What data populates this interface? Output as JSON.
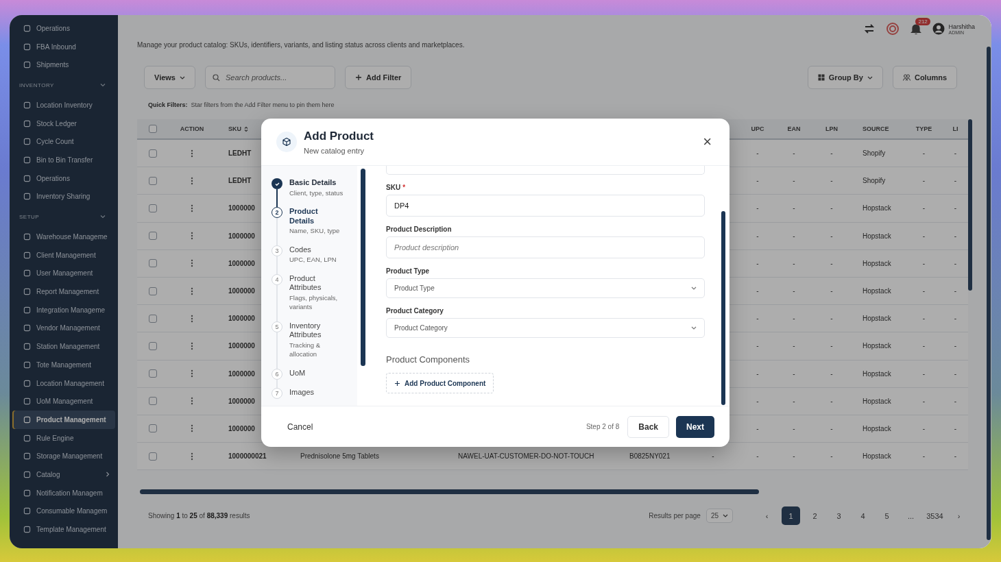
{
  "sidebar": {
    "items": [
      {
        "kind": "item",
        "label": "Operations",
        "selected": false
      },
      {
        "kind": "item",
        "label": "FBA Inbound",
        "selected": false
      },
      {
        "kind": "item",
        "label": "Shipments",
        "selected": false
      },
      {
        "kind": "section",
        "label": "INVENTORY"
      },
      {
        "kind": "item",
        "label": "Location Inventory",
        "selected": false
      },
      {
        "kind": "item",
        "label": "Stock Ledger",
        "selected": false
      },
      {
        "kind": "item",
        "label": "Cycle Count",
        "selected": false
      },
      {
        "kind": "item",
        "label": "Bin to Bin Transfer",
        "selected": false
      },
      {
        "kind": "item",
        "label": "Operations",
        "selected": false
      },
      {
        "kind": "item",
        "label": "Inventory Sharing",
        "selected": false
      },
      {
        "kind": "section",
        "label": "SETUP"
      },
      {
        "kind": "item",
        "label": "Warehouse Manageme",
        "selected": false
      },
      {
        "kind": "item",
        "label": "Client Management",
        "selected": false
      },
      {
        "kind": "item",
        "label": "User Management",
        "selected": false
      },
      {
        "kind": "item",
        "label": "Report Management",
        "selected": false
      },
      {
        "kind": "item",
        "label": "Integration Manageme",
        "selected": false
      },
      {
        "kind": "item",
        "label": "Vendor Management",
        "selected": false
      },
      {
        "kind": "item",
        "label": "Station Management",
        "selected": false
      },
      {
        "kind": "item",
        "label": "Tote Management",
        "selected": false
      },
      {
        "kind": "item",
        "label": "Location Management",
        "selected": false
      },
      {
        "kind": "item",
        "label": "UoM Management",
        "selected": false
      },
      {
        "kind": "item",
        "label": "Product Management",
        "selected": true
      },
      {
        "kind": "item",
        "label": "Rule Engine",
        "selected": false
      },
      {
        "kind": "item",
        "label": "Storage Management",
        "selected": false
      },
      {
        "kind": "item",
        "label": "Catalog",
        "selected": false,
        "expanded": false
      },
      {
        "kind": "item",
        "label": "Notification Managem",
        "selected": false
      },
      {
        "kind": "item",
        "label": "Consumable Managem",
        "selected": false
      },
      {
        "kind": "item",
        "label": "Template Management",
        "selected": false
      }
    ]
  },
  "header": {
    "description": "Manage your product catalog: SKUs, identifiers, variants, and listing status across clients and marketplaces.",
    "notification_count": "212",
    "user_name": "Harshitha",
    "user_role": "ADMIN"
  },
  "toolbar": {
    "views": "Views",
    "search_placeholder": "Search products...",
    "add_filter": "Add Filter",
    "group_by": "Group By",
    "columns": "Columns"
  },
  "quick_filters": {
    "label": "Quick Filters:",
    "hint": "Star filters from the Add Filter menu to pin them here"
  },
  "table": {
    "header_checked": false,
    "columns": [
      "",
      "ACTION",
      "SKU",
      "",
      "",
      "",
      "",
      "UPC",
      "EAN",
      "LPN",
      "SOURCE",
      "TYPE",
      "LI"
    ],
    "rows": [
      {
        "checked": false,
        "cells": [
          "",
          "",
          "LEDHT",
          "",
          "",
          "",
          "",
          "-",
          "-",
          "-",
          "Shopify",
          "-",
          "-"
        ]
      },
      {
        "checked": false,
        "cells": [
          "",
          "",
          "LEDHT",
          "",
          "",
          "",
          "",
          "-",
          "-",
          "-",
          "Shopify",
          "-",
          "-"
        ]
      },
      {
        "checked": false,
        "cells": [
          "",
          "",
          "1000000",
          "",
          "",
          "",
          "",
          "-",
          "-",
          "-",
          "Hopstack",
          "-",
          "-"
        ]
      },
      {
        "checked": false,
        "cells": [
          "",
          "",
          "1000000",
          "",
          "",
          "",
          "",
          "-",
          "-",
          "-",
          "Hopstack",
          "-",
          "-"
        ]
      },
      {
        "checked": false,
        "cells": [
          "",
          "",
          "1000000",
          "",
          "",
          "",
          "",
          "-",
          "-",
          "-",
          "Hopstack",
          "-",
          "-"
        ]
      },
      {
        "checked": false,
        "cells": [
          "",
          "",
          "1000000",
          "",
          "",
          "",
          "",
          "-",
          "-",
          "-",
          "Hopstack",
          "-",
          "-"
        ]
      },
      {
        "checked": false,
        "cells": [
          "",
          "",
          "1000000",
          "",
          "",
          "",
          "",
          "-",
          "-",
          "-",
          "Hopstack",
          "-",
          "-"
        ]
      },
      {
        "checked": false,
        "cells": [
          "",
          "",
          "1000000",
          "",
          "",
          "",
          "",
          "-",
          "-",
          "-",
          "Hopstack",
          "-",
          "-"
        ]
      },
      {
        "checked": false,
        "cells": [
          "",
          "",
          "1000000",
          "",
          "",
          "",
          "",
          "-",
          "-",
          "-",
          "Hopstack",
          "-",
          "-"
        ]
      },
      {
        "checked": false,
        "cells": [
          "",
          "",
          "1000000",
          "",
          "",
          "",
          "",
          "-",
          "-",
          "-",
          "Hopstack",
          "-",
          "-"
        ]
      },
      {
        "checked": false,
        "cells": [
          "",
          "",
          "1000000",
          "",
          "",
          "",
          "",
          "-",
          "-",
          "-",
          "Hopstack",
          "-",
          "-"
        ]
      },
      {
        "checked": false,
        "cells": [
          "",
          "",
          "1000000021",
          "Prednisolone 5mg Tablets",
          "NAWEL-UAT-CUSTOMER-DO-NOT-TOUCH",
          "B0825NY021",
          "-",
          "-",
          "-",
          "-",
          "Hopstack",
          "-",
          "-"
        ]
      }
    ]
  },
  "pagination": {
    "summary": "Showing **1** to **25** of **88,339** results",
    "per_page_label": "Results per page",
    "per_page": "25",
    "prev": "‹",
    "next": "›",
    "pages": [
      {
        "label": "1",
        "selected": true
      },
      {
        "label": "2",
        "selected": false
      },
      {
        "label": "3",
        "selected": false
      },
      {
        "label": "4",
        "selected": false
      },
      {
        "label": "5",
        "selected": false
      },
      {
        "label": "...",
        "selected": false
      },
      {
        "label": "3534",
        "selected": false
      }
    ]
  },
  "modal": {
    "title": "Add Product",
    "subtitle": "New catalog entry",
    "close": "×",
    "steps": [
      {
        "title": "Basic Details",
        "subtitle": "Client, type, status",
        "kind": "done"
      },
      {
        "number": "2",
        "title": "Product Details",
        "subtitle": "Name, SKU, type",
        "kind": "current"
      },
      {
        "number": "3",
        "title": "Codes",
        "subtitle": "UPC, EAN, LPN",
        "kind": "pending"
      },
      {
        "number": "4",
        "title": "Product Attributes",
        "subtitle": "Flags, physicals, variants",
        "kind": "pending"
      },
      {
        "number": "5",
        "title": "Inventory Attributes",
        "subtitle": "Tracking & allocation",
        "kind": "pending"
      },
      {
        "number": "6",
        "title": "UoM",
        "kind": "pending"
      },
      {
        "number": "7",
        "title": "Images",
        "kind": "pending"
      }
    ],
    "fields": [
      {
        "kind": "text",
        "label": "SKU",
        "required_mark": "*",
        "value": "DP4"
      },
      {
        "kind": "text",
        "label": "Product Description",
        "placeholder": "Product description"
      },
      {
        "kind": "select",
        "label": "Product Type",
        "value": "Product Type"
      },
      {
        "kind": "select",
        "label": "Product Category",
        "value": "Product Category"
      }
    ],
    "components_title": "Product Components",
    "add_component": "Add Product Component",
    "footer": {
      "cancel": "Cancel",
      "step": "Step 2 of 8",
      "back": "Back",
      "next": "Next"
    }
  }
}
